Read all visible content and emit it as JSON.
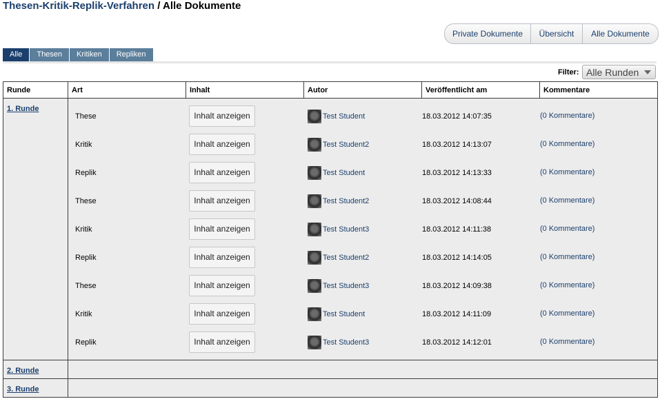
{
  "breadcrumb": {
    "parent": "Thesen-Kritik-Replik-Verfahren",
    "separator": " / ",
    "current": "Alle Dokumente"
  },
  "top_nav": [
    "Private Dokumente",
    "Übersicht",
    "Alle Dokumente"
  ],
  "tabs": [
    "Alle",
    "Thesen",
    "Kritiken",
    "Repliken"
  ],
  "filter": {
    "label": "Filter:",
    "value": "Alle Runden"
  },
  "columns": [
    "Runde",
    "Art",
    "Inhalt",
    "Autor",
    "Veröffentlicht am",
    "Kommentare"
  ],
  "rounds": [
    {
      "name": "1. Runde",
      "rows": [
        {
          "art": "These",
          "button": "Inhalt anzeigen",
          "autor": "Test Student",
          "datum": "18.03.2012 14:07:35",
          "kommentare": "(0 Kommentare)"
        },
        {
          "art": "Kritik",
          "button": "Inhalt anzeigen",
          "autor": "Test Student2",
          "datum": "18.03.2012 14:13:07",
          "kommentare": "(0 Kommentare)"
        },
        {
          "art": "Replik",
          "button": "Inhalt anzeigen",
          "autor": "Test Student",
          "datum": "18.03.2012 14:13:33",
          "kommentare": "(0 Kommentare)"
        },
        {
          "art": "These",
          "button": "Inhalt anzeigen",
          "autor": "Test Student2",
          "datum": "18.03.2012 14:08:44",
          "kommentare": "(0 Kommentare)"
        },
        {
          "art": "Kritik",
          "button": "Inhalt anzeigen",
          "autor": "Test Student3",
          "datum": "18.03.2012 14:11:38",
          "kommentare": "(0 Kommentare)"
        },
        {
          "art": "Replik",
          "button": "Inhalt anzeigen",
          "autor": "Test Student2",
          "datum": "18.03.2012 14:14:05",
          "kommentare": "(0 Kommentare)"
        },
        {
          "art": "These",
          "button": "Inhalt anzeigen",
          "autor": "Test Student3",
          "datum": "18.03.2012 14:09:38",
          "kommentare": "(0 Kommentare)"
        },
        {
          "art": "Kritik",
          "button": "Inhalt anzeigen",
          "autor": "Test Student",
          "datum": "18.03.2012 14:11:09",
          "kommentare": "(0 Kommentare)"
        },
        {
          "art": "Replik",
          "button": "Inhalt anzeigen",
          "autor": "Test Student3",
          "datum": "18.03.2012 14:12:01",
          "kommentare": "(0 Kommentare)"
        }
      ]
    },
    {
      "name": "2. Runde",
      "rows": []
    },
    {
      "name": "3. Runde",
      "rows": []
    }
  ],
  "icons": {
    "avatar": "user-avatar-icon",
    "dropdown": "chevron-down-icon"
  },
  "colors": {
    "link": "#1b3f6d",
    "tab_active": "#1b3f6d",
    "tab_inactive": "#5b7e9b",
    "row_bg": "#ececec"
  }
}
